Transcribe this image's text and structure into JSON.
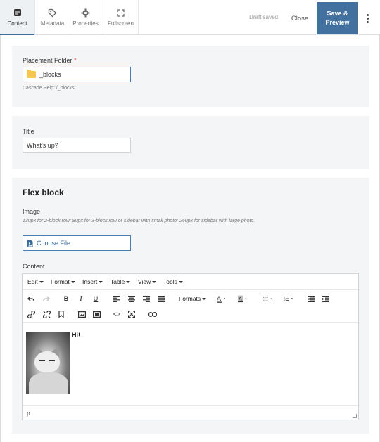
{
  "tabs": [
    {
      "label": "Content",
      "icon": "content-icon",
      "active": true
    },
    {
      "label": "Metadata",
      "icon": "tag-icon"
    },
    {
      "label": "Properties",
      "icon": "gear-icon"
    },
    {
      "label": "Fullscreen",
      "icon": "fullscreen-icon"
    }
  ],
  "header": {
    "status": "Draft saved",
    "close_label": "Close",
    "save_label": "Save &\nPreview"
  },
  "placement": {
    "label": "Placement Folder",
    "required_mark": "*",
    "value": "_blocks",
    "help": "Cascade Help: /_blocks"
  },
  "title_field": {
    "label": "Title",
    "value": "What's up?"
  },
  "flex_block": {
    "heading": "Flex block",
    "image_label": "Image",
    "image_help": "130px for 2-block row; 80px for 3-block row or sidebar with small photo; 260px for sidebar with large photo.",
    "choose_file": "Choose File",
    "content_label": "Content"
  },
  "editor": {
    "menus": [
      "Edit",
      "Format",
      "Insert",
      "Table",
      "View",
      "Tools"
    ],
    "formats_label": "Formats",
    "body_text": "Hi!",
    "status_path": "p"
  },
  "colors": {
    "accent": "#4271a0",
    "panel": "#f4f5f7",
    "required": "#d9342b"
  }
}
